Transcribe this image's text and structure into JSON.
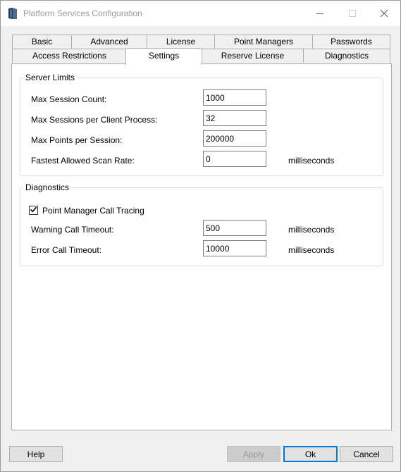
{
  "window": {
    "title": "Platform Services Configuration"
  },
  "tabs": {
    "row1": [
      {
        "label": "Basic"
      },
      {
        "label": "Advanced"
      },
      {
        "label": "License"
      },
      {
        "label": "Point Managers"
      },
      {
        "label": "Passwords"
      }
    ],
    "row2": [
      {
        "label": "Access Restrictions"
      },
      {
        "label": "Settings",
        "active": true
      },
      {
        "label": "Reserve License"
      },
      {
        "label": "Diagnostics"
      }
    ]
  },
  "server_limits": {
    "title": "Server Limits",
    "max_session_count": {
      "label": "Max Session Count:",
      "value": "1000"
    },
    "max_sessions_per_client": {
      "label": "Max Sessions per Client Process:",
      "value": "32"
    },
    "max_points_per_session": {
      "label": "Max Points per Session:",
      "value": "200000"
    },
    "fastest_scan_rate": {
      "label": "Fastest Allowed Scan Rate:",
      "value": "0",
      "unit": "milliseconds"
    }
  },
  "diagnostics": {
    "title": "Diagnostics",
    "call_tracing": {
      "label": "Point Manager Call Tracing",
      "checked": true
    },
    "warning_timeout": {
      "label": "Warning Call Timeout:",
      "value": "500",
      "unit": "milliseconds"
    },
    "error_timeout": {
      "label": "Error Call Timeout:",
      "value": "10000",
      "unit": "milliseconds"
    }
  },
  "buttons": {
    "help": "Help",
    "apply": "Apply",
    "ok": "Ok",
    "cancel": "Cancel"
  },
  "icons": {
    "app": "book-icon",
    "minimize": "minimize-icon",
    "maximize": "maximize-icon",
    "close": "close-icon",
    "check": "checkmark-icon"
  },
  "colors": {
    "accent": "#0078d7",
    "app_icon": "#1f3c5a"
  }
}
